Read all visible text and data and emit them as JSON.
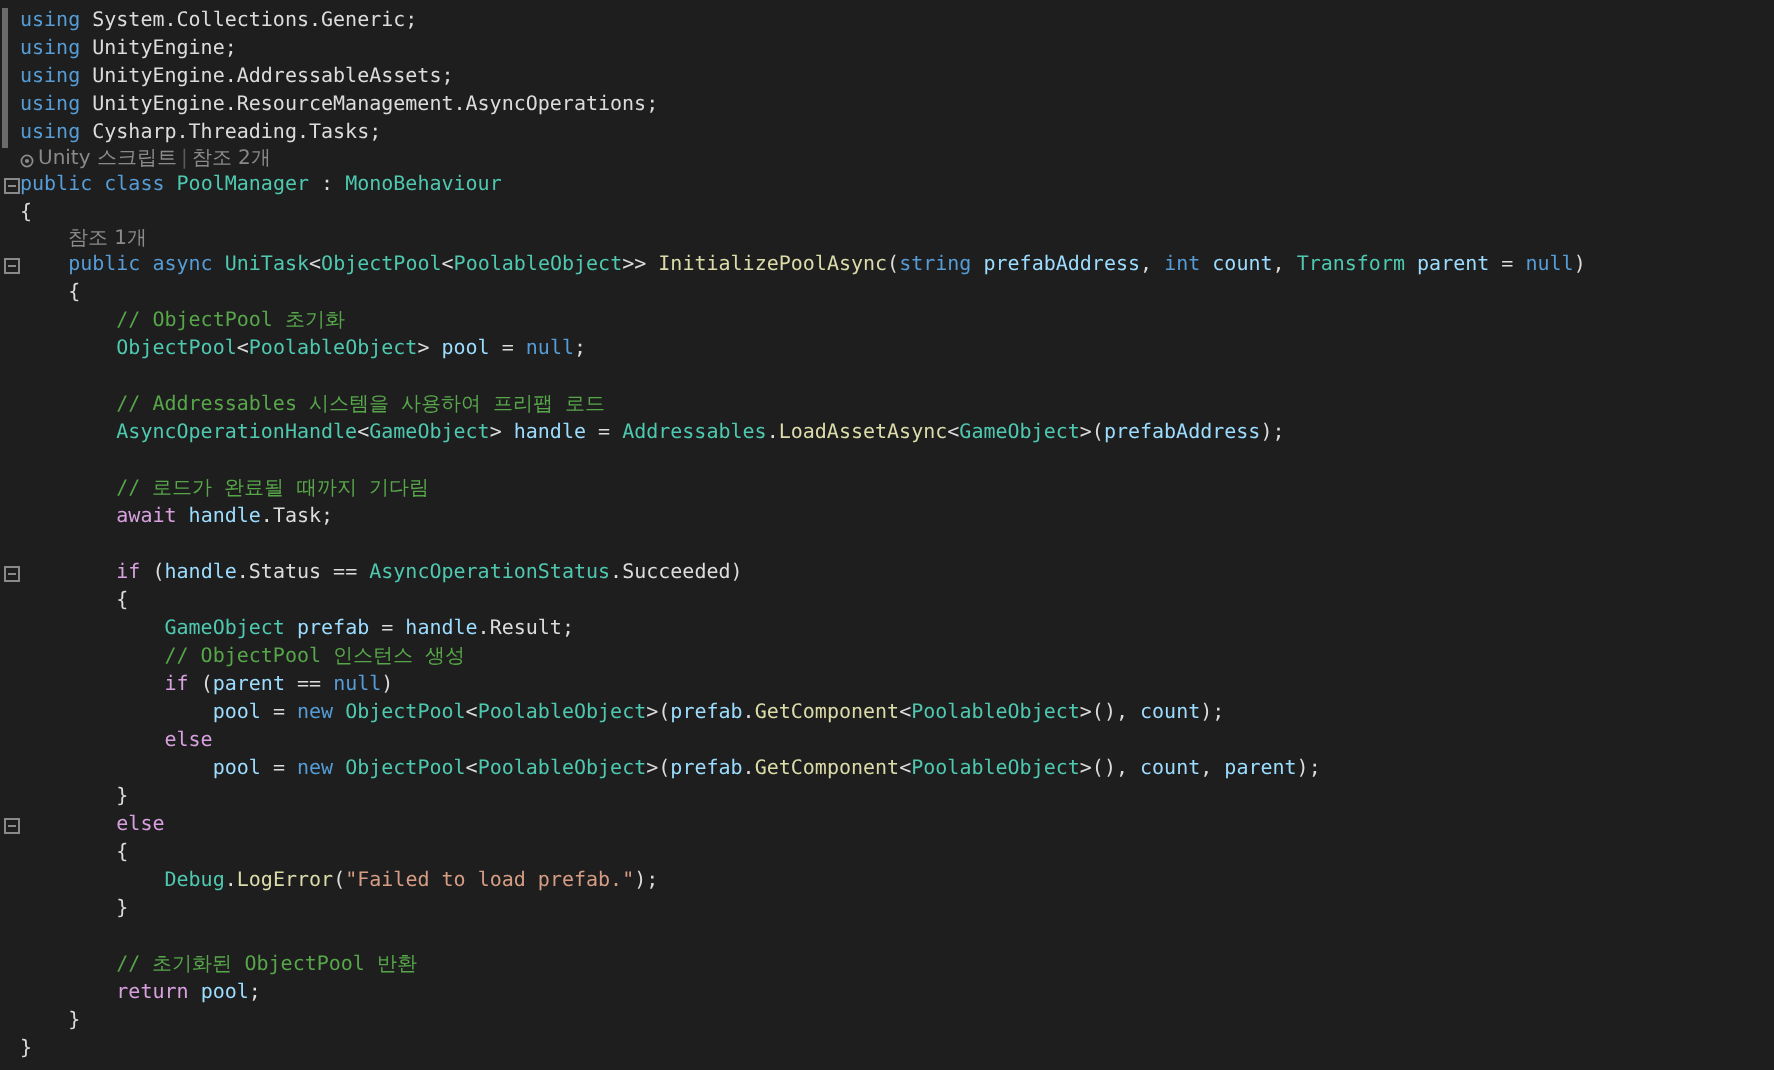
{
  "editor": {
    "lines": [
      {
        "kind": "code",
        "modified": true,
        "tokens": [
          {
            "text": "using ",
            "kind": "kw"
          },
          {
            "text": "System.Collections.Generic;",
            "kind": "p"
          }
        ]
      },
      {
        "kind": "code",
        "modified": true,
        "tokens": [
          {
            "text": "using ",
            "kind": "kw"
          },
          {
            "text": "UnityEngine;",
            "kind": "p"
          }
        ]
      },
      {
        "kind": "code",
        "modified": true,
        "tokens": [
          {
            "text": "using ",
            "kind": "kw"
          },
          {
            "text": "UnityEngine.AddressableAssets;",
            "kind": "p"
          }
        ]
      },
      {
        "kind": "code",
        "modified": true,
        "tokens": [
          {
            "text": "using ",
            "kind": "kw"
          },
          {
            "text": "UnityEngine.ResourceManagement.AsyncOperations;",
            "kind": "p"
          }
        ]
      },
      {
        "kind": "code",
        "modified": true,
        "tokens": [
          {
            "text": "using ",
            "kind": "kw"
          },
          {
            "text": "Cysharp.Threading.Tasks;",
            "kind": "p"
          }
        ]
      },
      {
        "kind": "lens",
        "icon": true,
        "separator": "|",
        "items": [
          "Unity 스크립트",
          "참조 2개"
        ]
      },
      {
        "kind": "code",
        "expanded": true,
        "tokens": [
          {
            "text": "public class ",
            "kind": "kw"
          },
          {
            "text": "PoolManager",
            "kind": "type"
          },
          {
            "text": " : ",
            "kind": "p"
          },
          {
            "text": "MonoBehaviour",
            "kind": "type"
          }
        ]
      },
      {
        "kind": "code",
        "tokens": [
          {
            "text": "{",
            "kind": "p"
          }
        ]
      },
      {
        "kind": "lens",
        "items": [
          "참조 1개"
        ]
      },
      {
        "kind": "code",
        "expanded": true,
        "tokens": [
          {
            "text": "    public async ",
            "kind": "kw"
          },
          {
            "text": "UniTask",
            "kind": "type"
          },
          {
            "text": "<",
            "kind": "p"
          },
          {
            "text": "ObjectPool",
            "kind": "type"
          },
          {
            "text": "<",
            "kind": "p"
          },
          {
            "text": "PoolableObject",
            "kind": "type"
          },
          {
            "text": ">> ",
            "kind": "p"
          },
          {
            "text": "InitializePoolAsync",
            "kind": "fn"
          },
          {
            "text": "(",
            "kind": "p"
          },
          {
            "text": "string ",
            "kind": "kw"
          },
          {
            "text": "prefabAddress",
            "kind": "var"
          },
          {
            "text": ", ",
            "kind": "p"
          },
          {
            "text": "int ",
            "kind": "kw"
          },
          {
            "text": "count",
            "kind": "var"
          },
          {
            "text": ", ",
            "kind": "p"
          },
          {
            "text": "Transform ",
            "kind": "type"
          },
          {
            "text": "parent",
            "kind": "var"
          },
          {
            "text": " = ",
            "kind": "p"
          },
          {
            "text": "null",
            "kind": "kw"
          },
          {
            "text": ")",
            "kind": "p"
          }
        ]
      },
      {
        "kind": "code",
        "tokens": [
          {
            "text": "    {",
            "kind": "p"
          }
        ]
      },
      {
        "kind": "code",
        "tokens": [
          {
            "text": "        // ObjectPool 초기화",
            "kind": "cm"
          }
        ]
      },
      {
        "kind": "code",
        "tokens": [
          {
            "text": "        ObjectPool",
            "kind": "type"
          },
          {
            "text": "<",
            "kind": "p"
          },
          {
            "text": "PoolableObject",
            "kind": "type"
          },
          {
            "text": "> ",
            "kind": "p"
          },
          {
            "text": "pool",
            "kind": "var"
          },
          {
            "text": " = ",
            "kind": "p"
          },
          {
            "text": "null",
            "kind": "kw"
          },
          {
            "text": ";",
            "kind": "p"
          }
        ]
      },
      {
        "kind": "blank"
      },
      {
        "kind": "code",
        "tokens": [
          {
            "text": "        // Addressables 시스템을 사용하여 프리팹 로드",
            "kind": "cm"
          }
        ]
      },
      {
        "kind": "code",
        "tokens": [
          {
            "text": "        AsyncOperationHandle",
            "kind": "type"
          },
          {
            "text": "<",
            "kind": "p"
          },
          {
            "text": "GameObject",
            "kind": "type"
          },
          {
            "text": "> ",
            "kind": "p"
          },
          {
            "text": "handle",
            "kind": "var"
          },
          {
            "text": " = ",
            "kind": "p"
          },
          {
            "text": "Addressables",
            "kind": "type"
          },
          {
            "text": ".",
            "kind": "p"
          },
          {
            "text": "LoadAssetAsync",
            "kind": "fn"
          },
          {
            "text": "<",
            "kind": "p"
          },
          {
            "text": "GameObject",
            "kind": "type"
          },
          {
            "text": ">(",
            "kind": "p"
          },
          {
            "text": "prefabAddress",
            "kind": "var"
          },
          {
            "text": ");",
            "kind": "p"
          }
        ]
      },
      {
        "kind": "blank"
      },
      {
        "kind": "code",
        "tokens": [
          {
            "text": "        // 로드가 완료될 때까지 기다림",
            "kind": "cm"
          }
        ]
      },
      {
        "kind": "code",
        "tokens": [
          {
            "text": "        await ",
            "kind": "ctl"
          },
          {
            "text": "handle",
            "kind": "var"
          },
          {
            "text": ".Task;",
            "kind": "p"
          }
        ]
      },
      {
        "kind": "blank"
      },
      {
        "kind": "code",
        "expanded": true,
        "tokens": [
          {
            "text": "        if ",
            "kind": "ctl"
          },
          {
            "text": "(",
            "kind": "p"
          },
          {
            "text": "handle",
            "kind": "var"
          },
          {
            "text": ".Status == ",
            "kind": "p"
          },
          {
            "text": "AsyncOperationStatus",
            "kind": "type"
          },
          {
            "text": ".Succeeded)",
            "kind": "p"
          }
        ]
      },
      {
        "kind": "code",
        "tokens": [
          {
            "text": "        {",
            "kind": "p"
          }
        ]
      },
      {
        "kind": "code",
        "tokens": [
          {
            "text": "            GameObject ",
            "kind": "type"
          },
          {
            "text": "prefab",
            "kind": "var"
          },
          {
            "text": " = ",
            "kind": "p"
          },
          {
            "text": "handle",
            "kind": "var"
          },
          {
            "text": ".Result;",
            "kind": "p"
          }
        ]
      },
      {
        "kind": "code",
        "tokens": [
          {
            "text": "            // ObjectPool 인스턴스 생성",
            "kind": "cm"
          }
        ]
      },
      {
        "kind": "code",
        "tokens": [
          {
            "text": "            if ",
            "kind": "ctl"
          },
          {
            "text": "(",
            "kind": "p"
          },
          {
            "text": "parent",
            "kind": "var"
          },
          {
            "text": " == ",
            "kind": "p"
          },
          {
            "text": "null",
            "kind": "kw"
          },
          {
            "text": ")",
            "kind": "p"
          }
        ]
      },
      {
        "kind": "code",
        "tokens": [
          {
            "text": "                pool",
            "kind": "var"
          },
          {
            "text": " = ",
            "kind": "p"
          },
          {
            "text": "new ",
            "kind": "kw"
          },
          {
            "text": "ObjectPool",
            "kind": "type"
          },
          {
            "text": "<",
            "kind": "p"
          },
          {
            "text": "PoolableObject",
            "kind": "type"
          },
          {
            "text": ">(",
            "kind": "p"
          },
          {
            "text": "prefab",
            "kind": "var"
          },
          {
            "text": ".",
            "kind": "p"
          },
          {
            "text": "GetComponent",
            "kind": "fn"
          },
          {
            "text": "<",
            "kind": "p"
          },
          {
            "text": "PoolableObject",
            "kind": "type"
          },
          {
            "text": ">(), ",
            "kind": "p"
          },
          {
            "text": "count",
            "kind": "var"
          },
          {
            "text": ");",
            "kind": "p"
          }
        ]
      },
      {
        "kind": "code",
        "tokens": [
          {
            "text": "            else",
            "kind": "ctl"
          }
        ]
      },
      {
        "kind": "code",
        "tokens": [
          {
            "text": "                pool",
            "kind": "var"
          },
          {
            "text": " = ",
            "kind": "p"
          },
          {
            "text": "new ",
            "kind": "kw"
          },
          {
            "text": "ObjectPool",
            "kind": "type"
          },
          {
            "text": "<",
            "kind": "p"
          },
          {
            "text": "PoolableObject",
            "kind": "type"
          },
          {
            "text": ">(",
            "kind": "p"
          },
          {
            "text": "prefab",
            "kind": "var"
          },
          {
            "text": ".",
            "kind": "p"
          },
          {
            "text": "GetComponent",
            "kind": "fn"
          },
          {
            "text": "<",
            "kind": "p"
          },
          {
            "text": "PoolableObject",
            "kind": "type"
          },
          {
            "text": ">(), ",
            "kind": "p"
          },
          {
            "text": "count",
            "kind": "var"
          },
          {
            "text": ", ",
            "kind": "p"
          },
          {
            "text": "parent",
            "kind": "var"
          },
          {
            "text": ");",
            "kind": "p"
          }
        ]
      },
      {
        "kind": "code",
        "tokens": [
          {
            "text": "        }",
            "kind": "p"
          }
        ]
      },
      {
        "kind": "code",
        "expanded": true,
        "tokens": [
          {
            "text": "        else",
            "kind": "ctl"
          }
        ]
      },
      {
        "kind": "code",
        "tokens": [
          {
            "text": "        {",
            "kind": "p"
          }
        ]
      },
      {
        "kind": "code",
        "tokens": [
          {
            "text": "            Debug",
            "kind": "type"
          },
          {
            "text": ".",
            "kind": "p"
          },
          {
            "text": "LogError",
            "kind": "fn"
          },
          {
            "text": "(",
            "kind": "p"
          },
          {
            "text": "\"Failed to load prefab.\"",
            "kind": "str"
          },
          {
            "text": ");",
            "kind": "p"
          }
        ]
      },
      {
        "kind": "code",
        "tokens": [
          {
            "text": "        }",
            "kind": "p"
          }
        ]
      },
      {
        "kind": "blank"
      },
      {
        "kind": "code",
        "tokens": [
          {
            "text": "        // 초기화된 ObjectPool 반환",
            "kind": "cm"
          }
        ]
      },
      {
        "kind": "code",
        "tokens": [
          {
            "text": "        return ",
            "kind": "ctl"
          },
          {
            "text": "pool",
            "kind": "var"
          },
          {
            "text": ";",
            "kind": "p"
          }
        ]
      },
      {
        "kind": "code",
        "tokens": [
          {
            "text": "    }",
            "kind": "p"
          }
        ]
      },
      {
        "kind": "code",
        "tokens": [
          {
            "text": "}",
            "kind": "p"
          }
        ]
      }
    ]
  }
}
